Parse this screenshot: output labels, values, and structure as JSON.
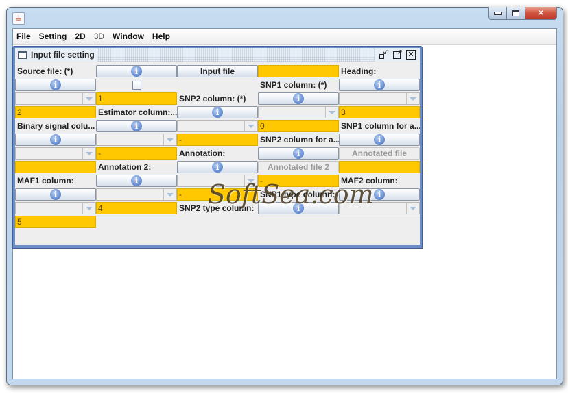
{
  "window": {
    "title": "",
    "controls": {
      "minimize": "minimize",
      "maximize": "maximize",
      "close": "✕"
    }
  },
  "menubar": {
    "items": [
      {
        "label": "File",
        "enabled": true
      },
      {
        "label": "Setting",
        "enabled": true
      },
      {
        "label": "2D",
        "enabled": true
      },
      {
        "label": "3D",
        "enabled": false
      },
      {
        "label": "Window",
        "enabled": true
      },
      {
        "label": "Help",
        "enabled": true
      }
    ]
  },
  "internal_frame": {
    "title": "Input file setting",
    "controls": {
      "iconify": "iconify",
      "maximize": "maximize",
      "close": "✕"
    }
  },
  "form": {
    "source_file_label": "Source file: (*)",
    "input_file_button": "Input file",
    "source_file_value": "",
    "heading_label": "Heading:",
    "heading_checked": false,
    "snp1_column_label": "SNP1 column: (*)",
    "snp1_column_value": "1",
    "snp2_column_label": "SNP2 column: (*)",
    "snp2_column_value": "2",
    "estimator_column_label": "Estimator column:...",
    "estimator_column_value": "3",
    "binary_signal_label": "Binary signal colu...",
    "binary_signal_value": "0",
    "snp1_column_annot_label": "SNP1 column for a...",
    "snp1_column_annot_value": "-",
    "snp2_column_annot_label": "SNP2 column for a...",
    "snp2_column_annot_value": "-",
    "annotation_label": "Annotation:",
    "annotated_file_button": "Annotated file",
    "annotation_value": "",
    "annotation2_label": "Annotation 2:",
    "annotated_file2_button": "Annotated file 2",
    "annotation2_value": "",
    "maf1_column_label": "MAF1 column:",
    "maf1_column_value": "-",
    "maf2_column_label": "MAF2 column:",
    "maf2_column_value": "-",
    "snp1_type_label": "SNP1 type column:",
    "snp1_type_value": "4",
    "snp2_type_label": "SNP2 type column:",
    "snp2_type_value": "5",
    "info_glyph": "i"
  },
  "watermark": "SoftSea.com",
  "colors": {
    "field_yellow": "#ffc800",
    "panel_bg": "#eeeeee",
    "frame_border": "#6b8ec7"
  }
}
